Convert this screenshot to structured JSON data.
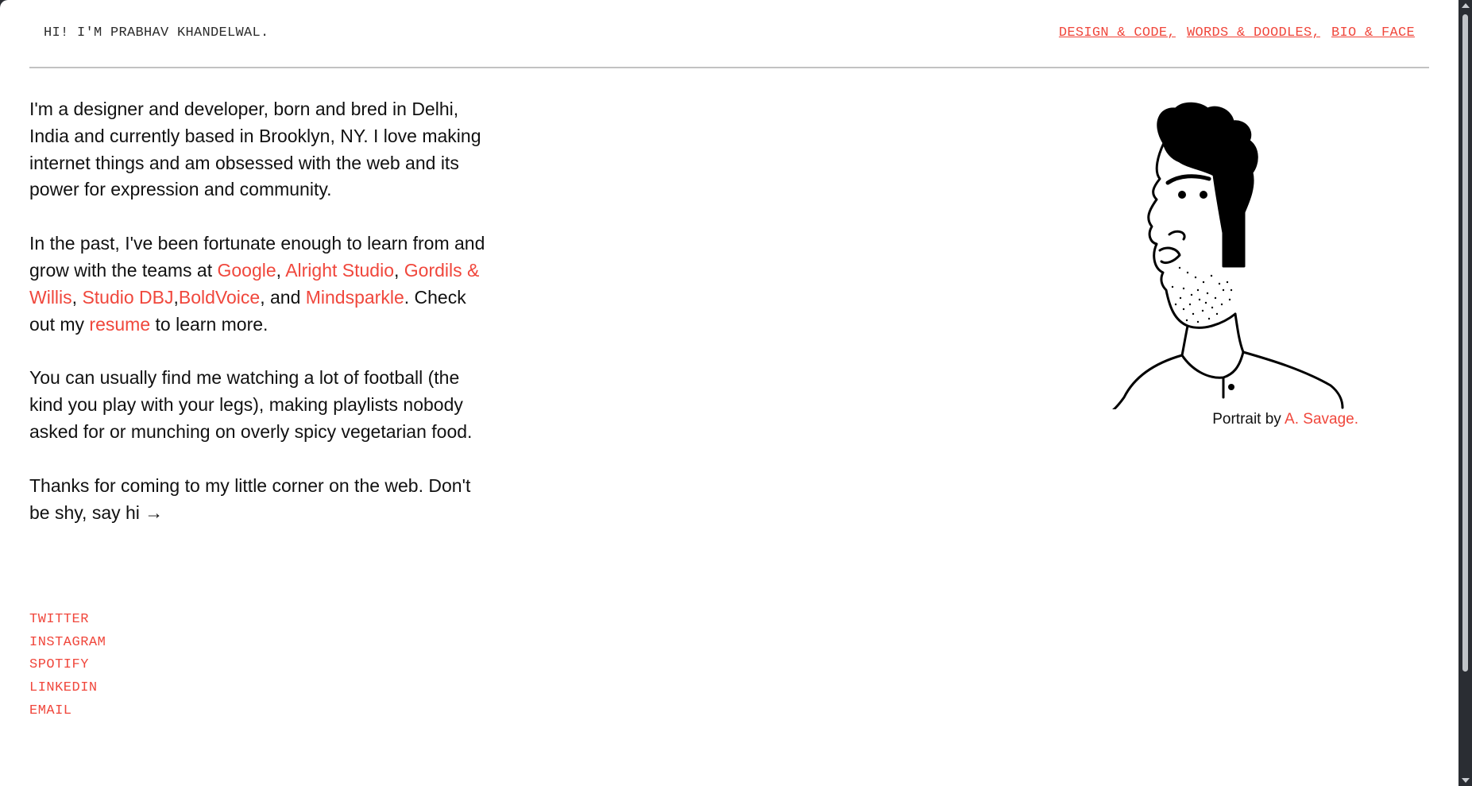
{
  "header": {
    "title": "HI! I'M PRABHAV KHANDELWAL.",
    "nav": [
      {
        "label": "DESIGN & CODE,"
      },
      {
        "label": "WORDS & DOODLES,"
      },
      {
        "label": "BIO & FACE"
      }
    ]
  },
  "bio": {
    "p1": "I'm a designer and developer, born and bred in Delhi, India and currently based in Brooklyn, NY. I love making internet things and am obsessed with the web and its power for expression and community.",
    "p2": {
      "intro": "In the past, I've been fortunate enough to learn from and grow with the teams at ",
      "google": "Google",
      "sep1": ", ",
      "alright": "Alright Studio",
      "sep2": ", ",
      "gordils": "Gordils & Willis",
      "sep3": ", ",
      "dbj": "Studio DBJ",
      "sep4": ",",
      "boldvoice": "BoldVoice",
      "sep5": ", and ",
      "mindsparkle": "Mindsparkle",
      "mid": ". Check out my ",
      "resume": "resume",
      "end": " to learn more."
    },
    "p3": "You can usually find me watching a lot of football (the kind you play with your legs), making playlists nobody asked for or munching on overly spicy vegetarian food.",
    "p4": "Thanks for coming to my little corner on the web. Don't be shy, say hi →"
  },
  "social": [
    "TWITTER",
    "INSTAGRAM",
    "SPOTIFY",
    "LINKEDIN",
    "EMAIL"
  ],
  "portrait": {
    "caption_prefix": "Portrait by ",
    "caption_link": "A. Savage."
  },
  "colors": {
    "accent": "#f0473c",
    "text": "#111111",
    "background": "#ffffff"
  },
  "icons": {
    "portrait": "portrait-illustration"
  }
}
